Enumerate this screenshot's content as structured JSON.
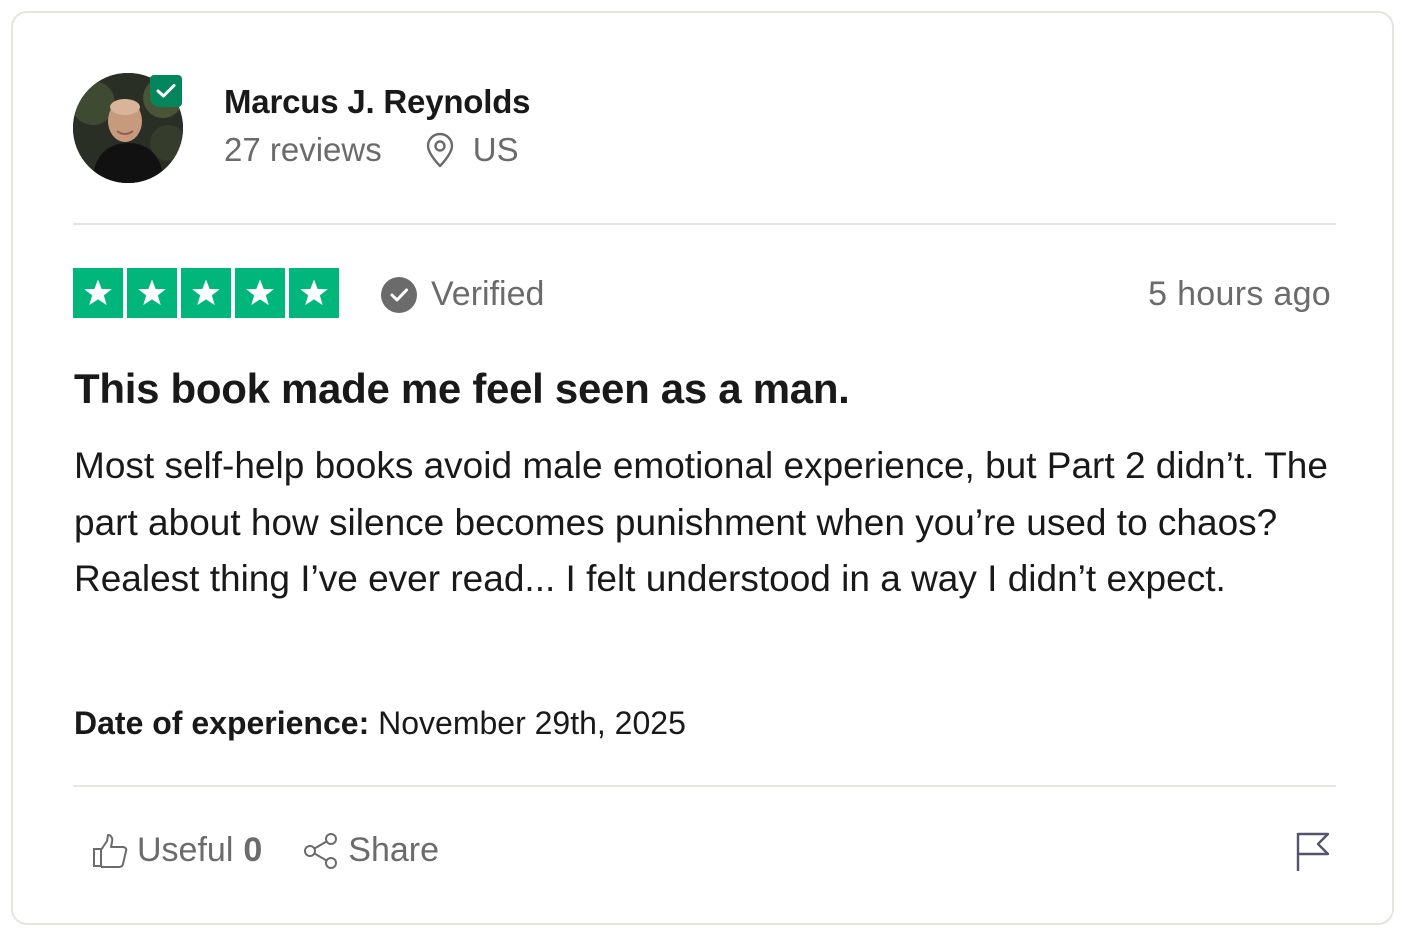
{
  "reviewer": {
    "name": "Marcus J. Reynolds",
    "review_count": "27 reviews",
    "location": "US",
    "verified_badge_icon": "check-icon"
  },
  "review": {
    "rating": 5,
    "rating_max": 5,
    "star_color": "#00b67a",
    "verified_label": "Verified",
    "posted": "5 hours ago",
    "title": "This book made me feel seen as a man.",
    "body": "Most self-help books avoid male emotional experience, but Part 2 didn’t. The part about how silence becomes punishment when you’re used to chaos? Realest thing I’ve ever read... I felt understood in a way I didn’t expect.",
    "experience_label": "Date of experience:",
    "experience_date": "November 29th, 2025"
  },
  "actions": {
    "useful_label": "Useful",
    "useful_count": "0",
    "share_label": "Share",
    "useful_icon": "thumbs-up-icon",
    "share_icon": "share-icon",
    "report_icon": "flag-icon"
  },
  "colors": {
    "verified_green": "#04865c",
    "muted_text": "#6b6b6b",
    "divider": "#e5e5dd"
  }
}
